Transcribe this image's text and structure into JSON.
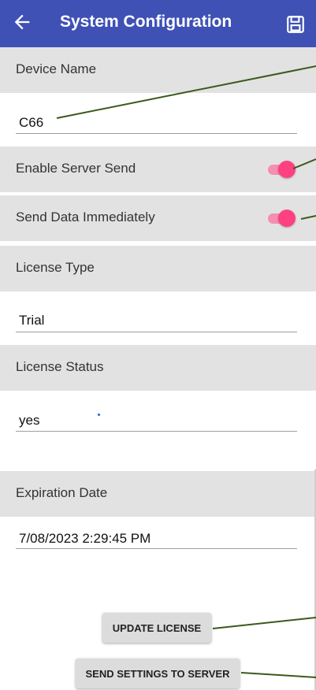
{
  "appbar": {
    "title": "System Configuration",
    "back_icon": "arrow-left-icon",
    "save_icon": "floppy-save-icon",
    "color": "#3f51b5"
  },
  "device_name": {
    "label": "Device Name",
    "value": "C66"
  },
  "enable_server_send": {
    "label": "Enable Server Send",
    "on": true
  },
  "send_data_immediately": {
    "label": "Send Data Immediately",
    "on": true
  },
  "license_type": {
    "label": "License Type",
    "value": "Trial"
  },
  "license_status": {
    "label": "License Status",
    "value": "yes"
  },
  "expiration_date": {
    "label": "Expiration Date",
    "value": "7/08/2023 2:29:45 PM"
  },
  "buttons": {
    "update_license": "UPDATE LICENSE",
    "send_settings": "SEND SETTINGS TO SERVER"
  },
  "colors": {
    "header_bg": "#e2e2e2",
    "accent": "#ff4081",
    "annotation_line": "#3a5a1a"
  }
}
